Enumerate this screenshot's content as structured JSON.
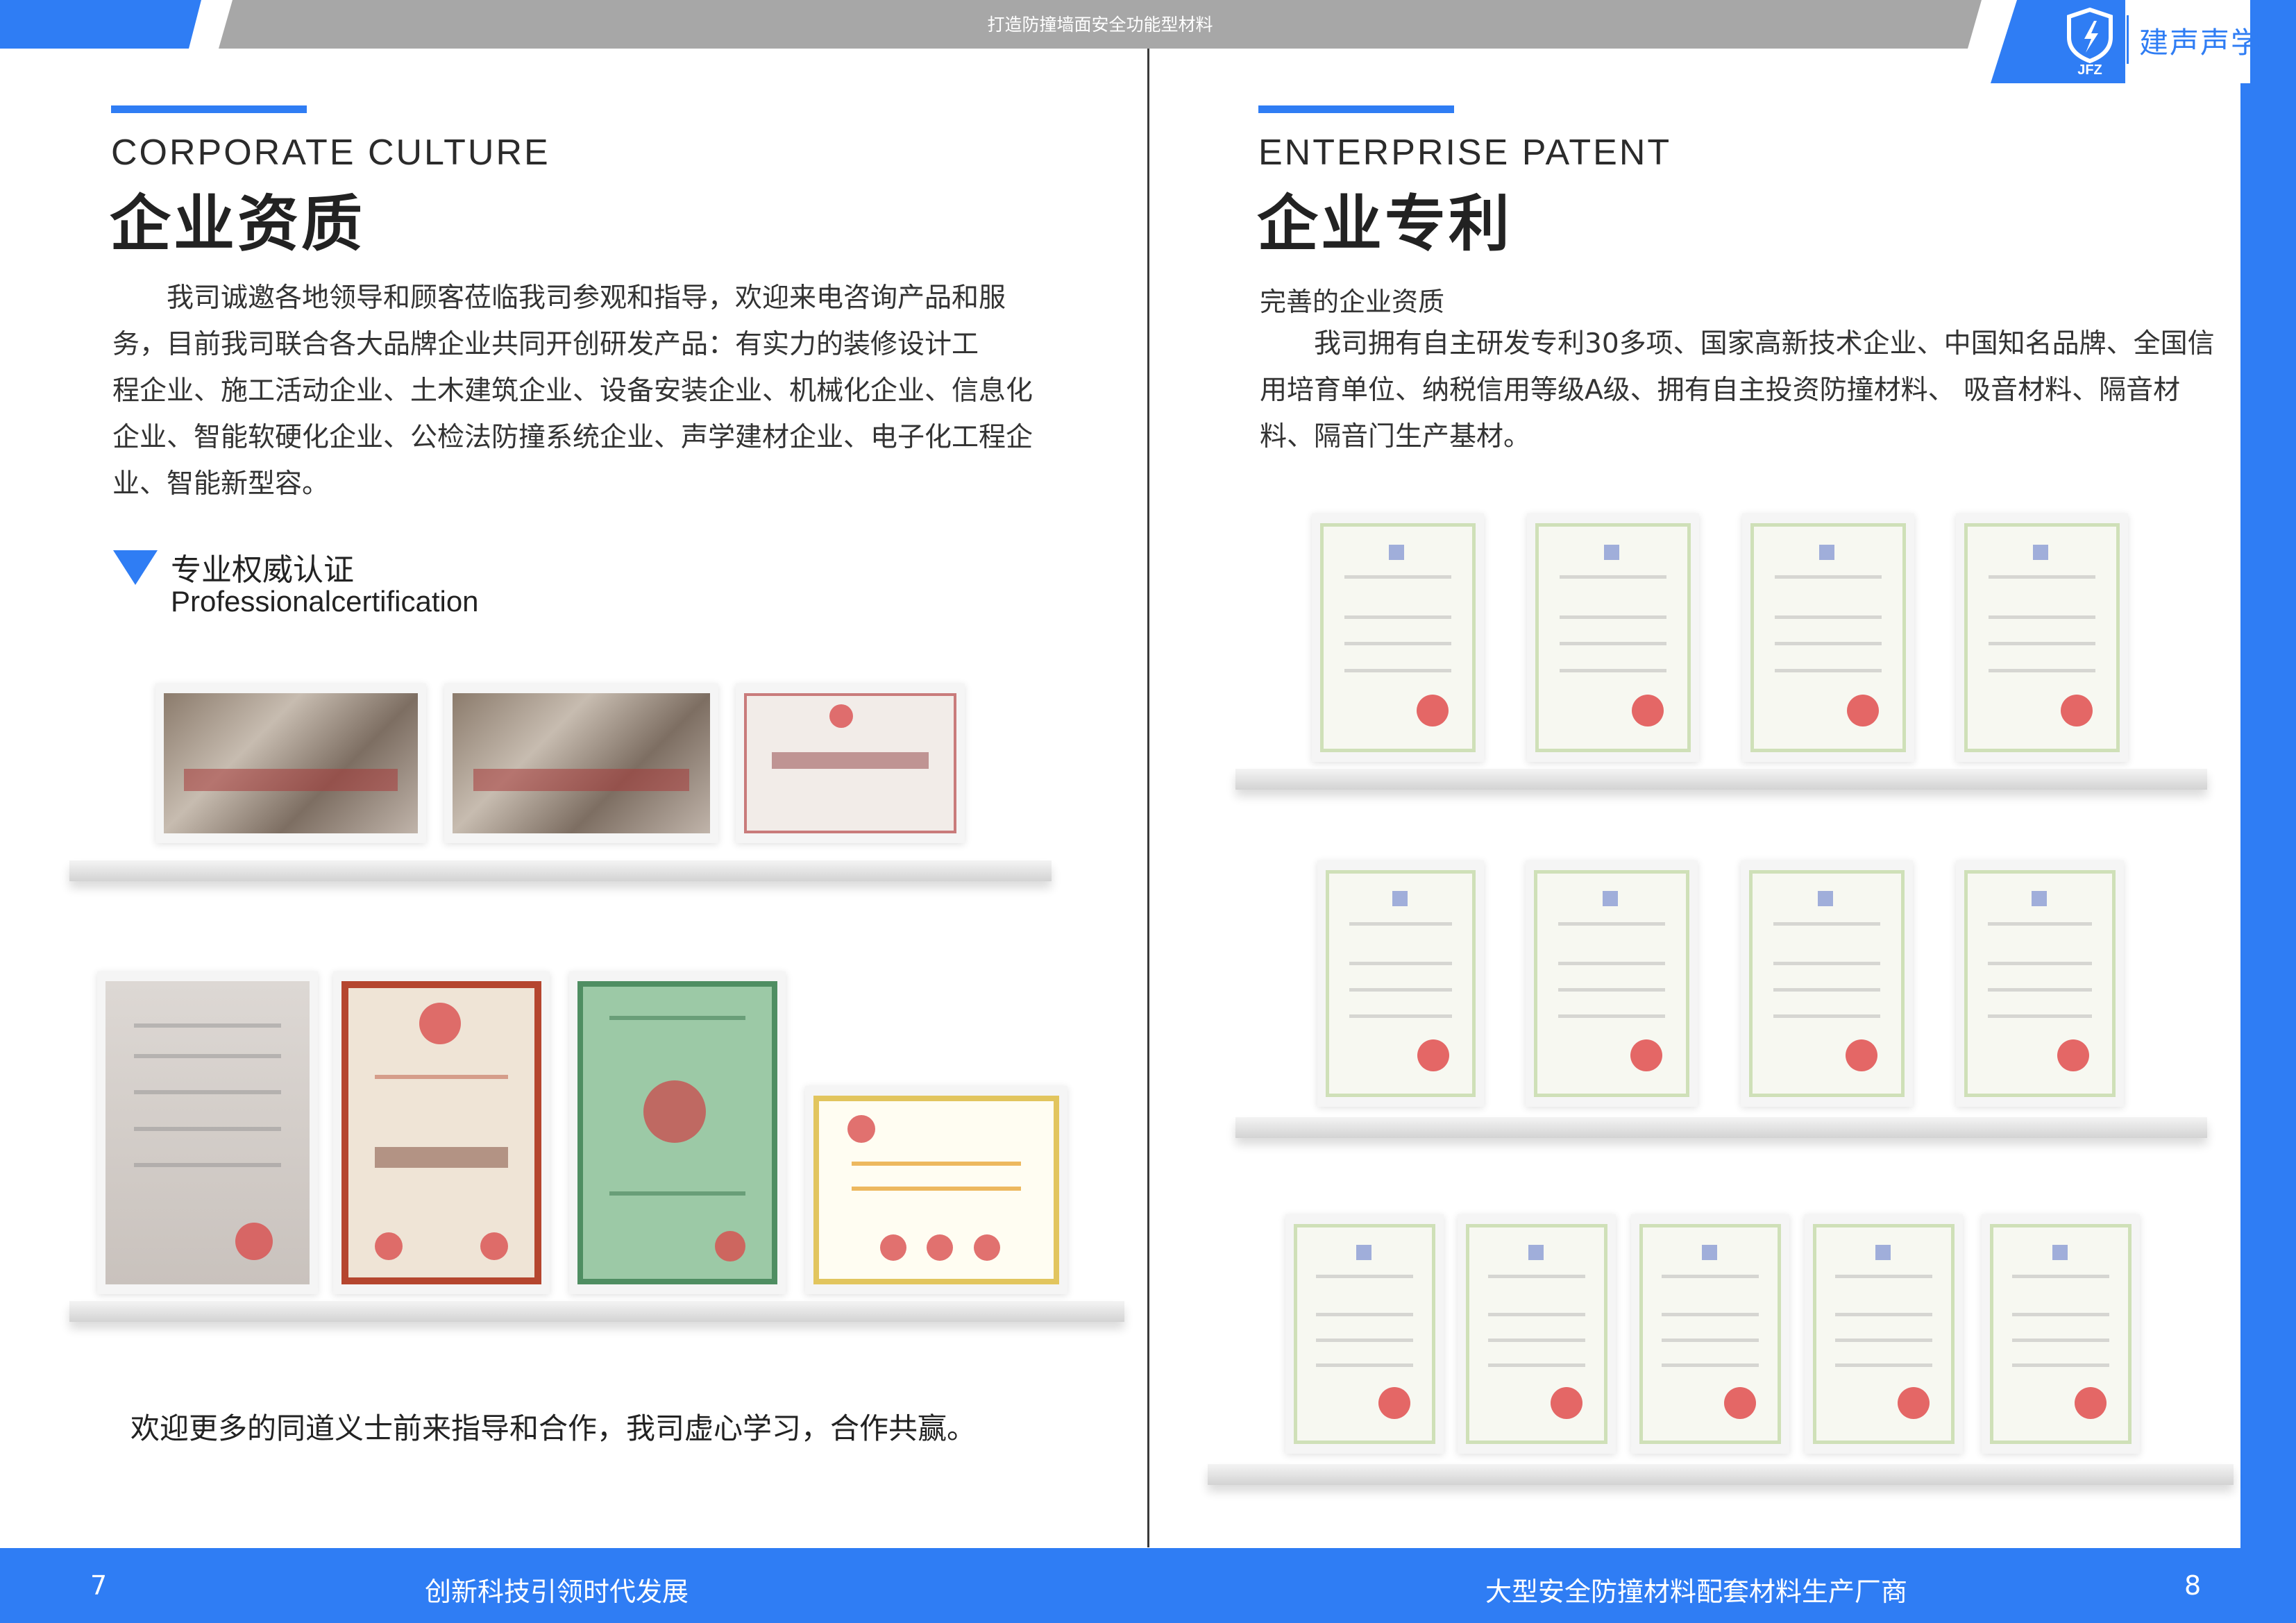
{
  "header": {
    "tagline": "打造防撞墙面安全功能型材料",
    "brand_name": "建声声学",
    "logo_icon": "jfz-shield-icon",
    "logo_text": "JFZ"
  },
  "left_page": {
    "title_en": "CORPORATE CULTURE",
    "title_cn": "企业资质",
    "paragraph_lines": [
      "　　我司诚邀各地领导和顾客莅临我司参观和指导，欢迎来电咨询产品和服",
      "务，目前我司联合各大品牌企业共同开创研发产品：有实力的装修设计工",
      "程企业、施工活动企业、土木建筑企业、设备安装企业、机械化企业、信息化",
      "企业、智能软硬化企业、公检法防撞系统企业、声学建材企业、电子化工程企",
      "业、智能新型容。"
    ],
    "subtitle_cn": "专业权威认证",
    "subtitle_en": "Professionalcertification",
    "closing_text": "欢迎更多的同道义士前来指导和合作，我司虚心学习，合作共赢。",
    "page_number": "7",
    "footer_slogan": "创新科技引领时代发展"
  },
  "right_page": {
    "title_en": "ENTERPRISE PATENT",
    "title_cn": "企业专利",
    "intro_heading": "完善的企业资质",
    "paragraph_lines": [
      "　　我司拥有自主研发专利30多项、国家高新技术企业、中国知名品牌、全国信",
      "用培育单位、纳税信用等级A级、拥有自主投资防撞材料、 吸音材料、隔音材",
      "料、隔音门生产基材。"
    ],
    "page_number": "8",
    "footer_slogan": "大型安全防撞材料配套材料生产厂商"
  },
  "colors": {
    "accent_blue": "#2f7df4",
    "header_gray": "#a7a7a7",
    "text_dark": "#222222"
  }
}
